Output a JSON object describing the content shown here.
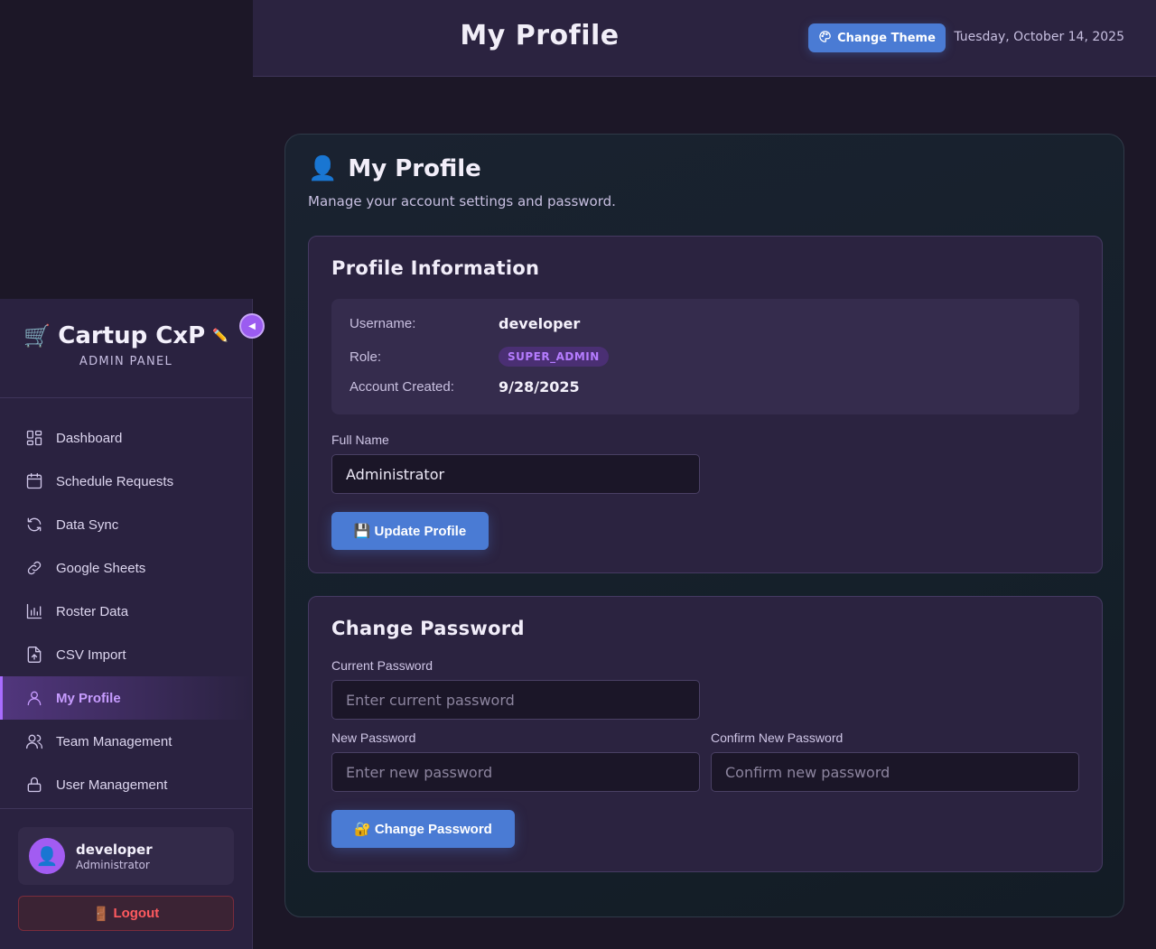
{
  "header": {
    "title": "My Profile",
    "theme_button_label": "Change Theme",
    "date": "Tuesday, October 14, 2025"
  },
  "sidebar": {
    "brand_icon": "🛒",
    "brand_name": "Cartup CxP",
    "brand_edit_icon": "✏️",
    "brand_subtitle": "ADMIN PANEL",
    "collapse_icon": "◀",
    "items": [
      {
        "label": "Dashboard",
        "icon": "dashboard-icon"
      },
      {
        "label": "Schedule Requests",
        "icon": "calendar-icon"
      },
      {
        "label": "Data Sync",
        "icon": "sync-icon"
      },
      {
        "label": "Google Sheets",
        "icon": "link-icon"
      },
      {
        "label": "Roster Data",
        "icon": "bar-chart-icon"
      },
      {
        "label": "CSV Import",
        "icon": "file-upload-icon"
      },
      {
        "label": "My Profile",
        "icon": "user-icon",
        "active": true
      },
      {
        "label": "Team Management",
        "icon": "users-icon"
      },
      {
        "label": "User Management",
        "icon": "lock-icon"
      }
    ],
    "user": {
      "avatar_icon": "👤",
      "name": "developer",
      "role": "Administrator"
    },
    "logout_icon": "🚪",
    "logout_label": "Logout"
  },
  "main": {
    "heading_icon": "👤",
    "heading": "My Profile",
    "description": "Manage your account settings and password.",
    "profile_info": {
      "title": "Profile Information",
      "username_label": "Username:",
      "username_value": "developer",
      "role_label": "Role:",
      "role_value": "SUPER_ADMIN",
      "created_label": "Account Created:",
      "created_value": "9/28/2025",
      "full_name_label": "Full Name",
      "full_name_value": "Administrator",
      "update_icon": "💾",
      "update_label": "Update Profile"
    },
    "change_password": {
      "title": "Change Password",
      "current_label": "Current Password",
      "current_placeholder": "Enter current password",
      "new_label": "New Password",
      "new_placeholder": "Enter new password",
      "confirm_label": "Confirm New Password",
      "confirm_placeholder": "Confirm new password",
      "button_icon": "🔐",
      "button_label": "Change Password"
    }
  },
  "colors": {
    "accent_blue": "#4a7bd4",
    "accent_purple": "#a86cff",
    "danger": "#ff5a5f",
    "background": "#1c1727",
    "panel": "#2b2340"
  }
}
